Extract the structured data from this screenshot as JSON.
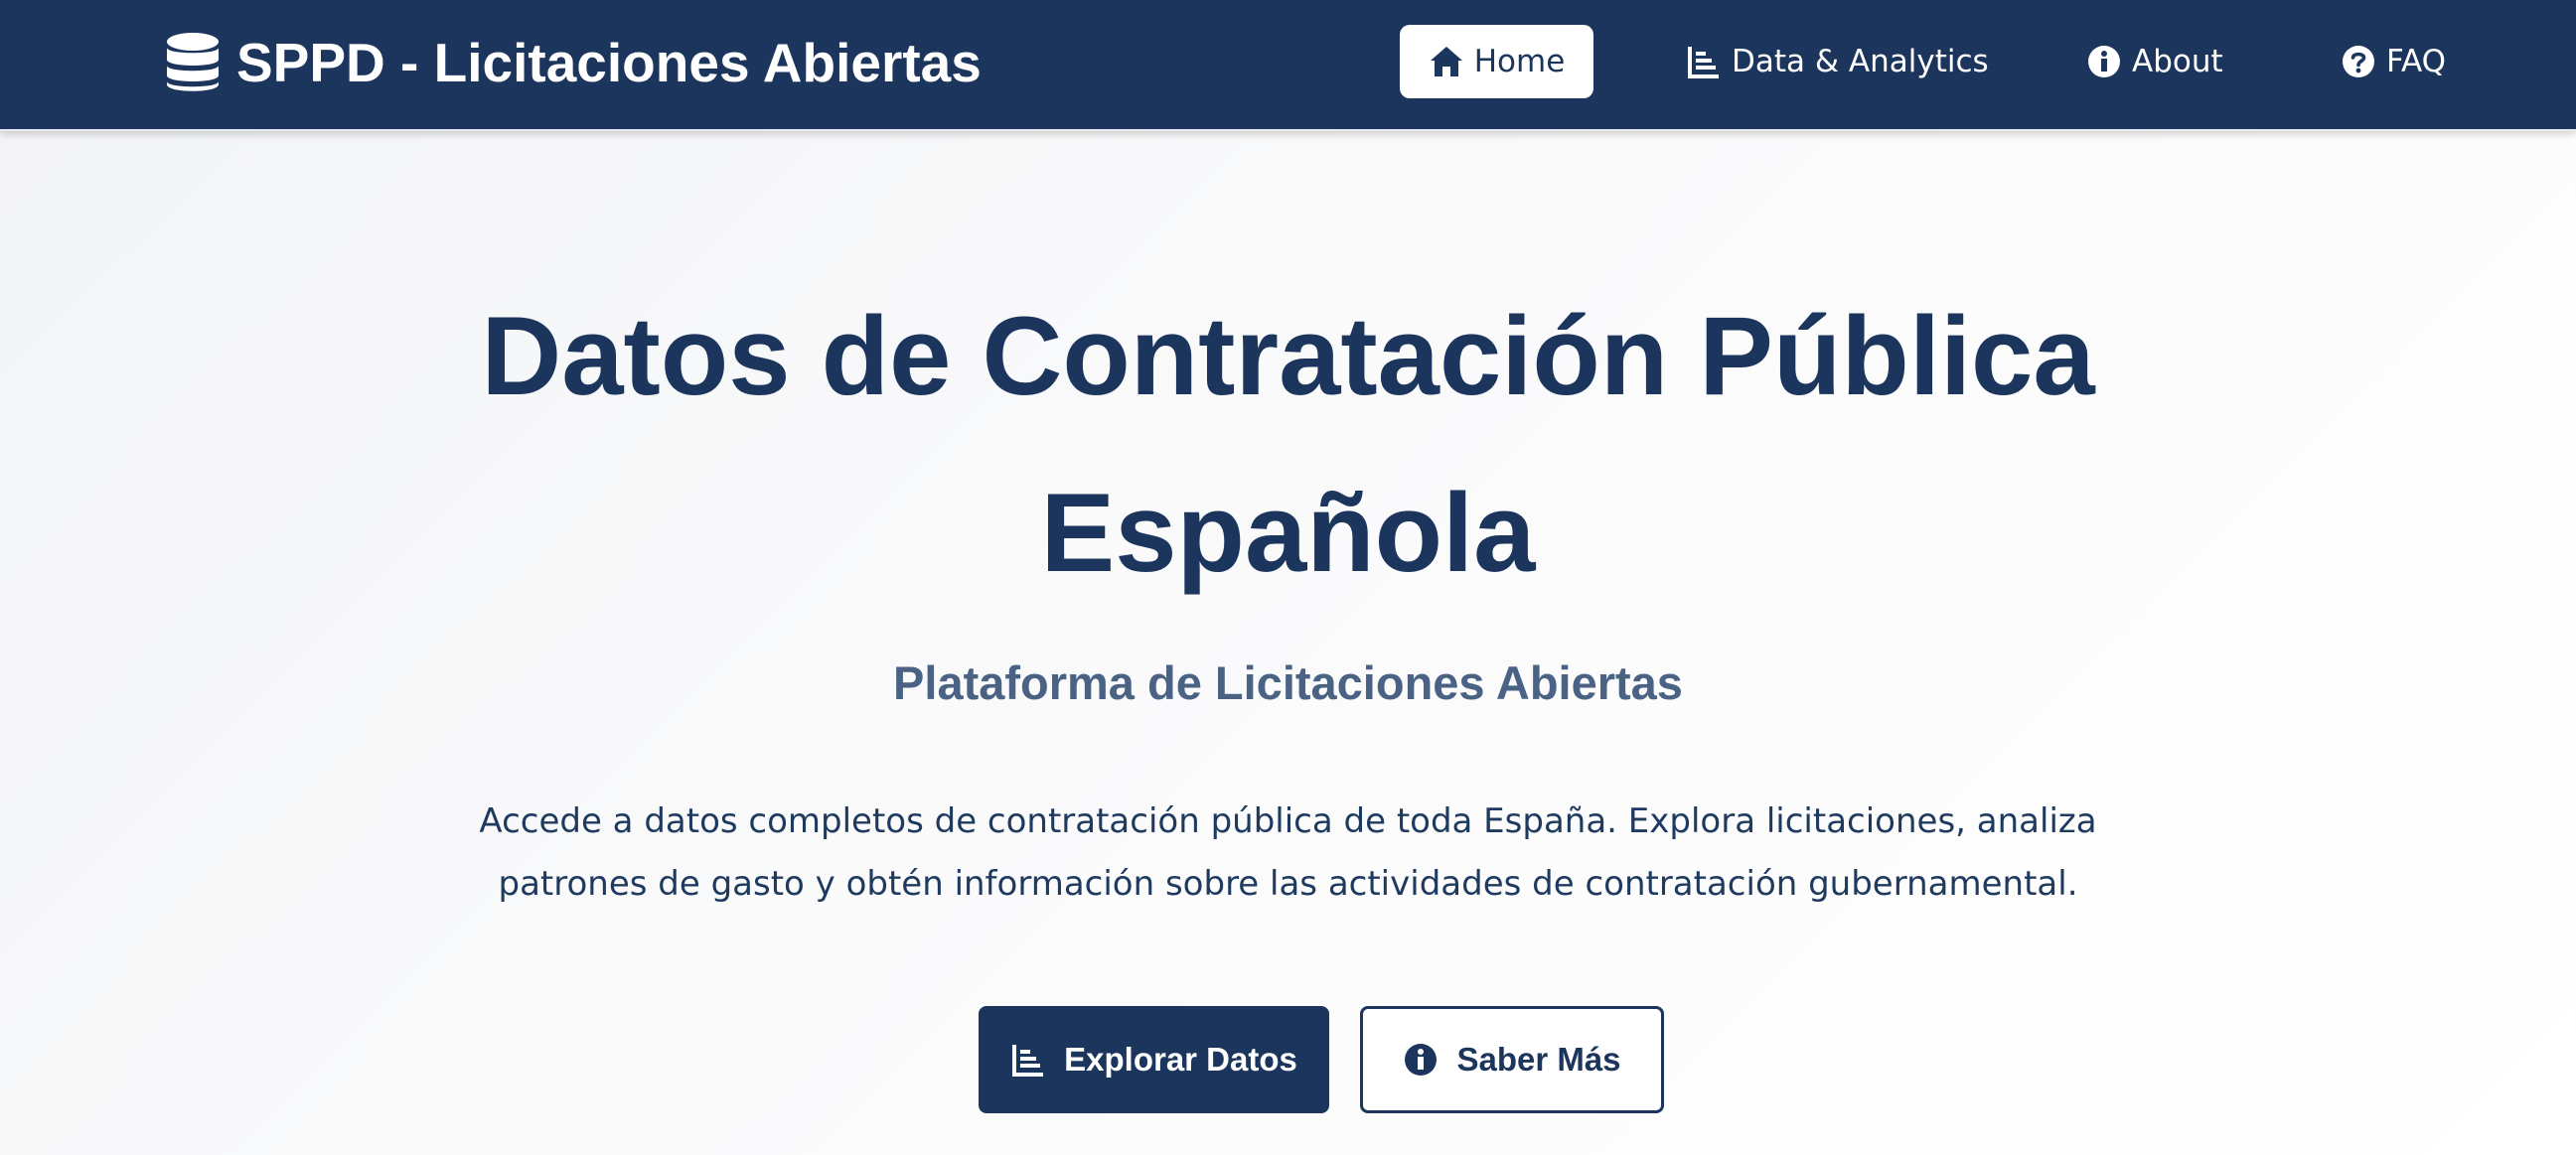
{
  "navbar": {
    "brand": {
      "icon": "database-icon",
      "title": "SPPD - Licitaciones Abiertas"
    },
    "items": [
      {
        "label": "Home",
        "icon": "home-icon",
        "active": true
      },
      {
        "label": "Data & Analytics",
        "icon": "chart-icon",
        "active": false
      },
      {
        "label": "About",
        "icon": "info-icon",
        "active": false
      },
      {
        "label": "FAQ",
        "icon": "question-icon",
        "active": false
      }
    ]
  },
  "hero": {
    "title_line1": "Datos de Contratación Pública",
    "title_line2": "Española",
    "subtitle": "Plataforma de Licitaciones Abiertas",
    "description_line1": "Accede a datos completos de contratación pública de toda España. Explora licitaciones, analiza",
    "description_line2": "patrones de gasto y obtén información sobre las actividades de contratación gubernamental.",
    "buttons": {
      "primary": {
        "label": "Explorar Datos",
        "icon": "chart-icon"
      },
      "secondary": {
        "label": "Saber Más",
        "icon": "info-icon"
      }
    }
  },
  "colors": {
    "navbar_bg": "#1c355c",
    "primary": "#1c355c",
    "subtitle": "#4a6385",
    "text": "#1e3a5f",
    "page_bg": "#f7f8fa"
  }
}
